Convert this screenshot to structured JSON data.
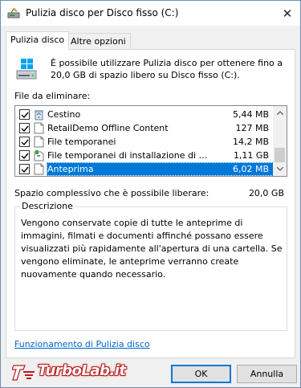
{
  "window": {
    "title": "Pulizia disco per Disco fisso (C:)"
  },
  "tabs": [
    {
      "label": "Pulizia disco"
    },
    {
      "label": "Altre opzioni"
    }
  ],
  "intro": "È possibile utilizzare Pulizia disco per ottenere fino a 20,0 GB di spazio libero su Disco fisso (C:).",
  "files_label": "File da eliminare:",
  "files": [
    {
      "name": "Cestino",
      "size": "5,44 MB",
      "checked": true,
      "icon": "recycle-bin-icon"
    },
    {
      "name": "RetailDemo Offline Content",
      "size": "127 MB",
      "checked": true,
      "icon": "file-icon"
    },
    {
      "name": "File temporanei",
      "size": "14,2 MB",
      "checked": true,
      "icon": "file-icon"
    },
    {
      "name": "File temporanei di installazione di Wind...",
      "size": "1,11 GB",
      "checked": true,
      "icon": "windows-setup-icon"
    },
    {
      "name": "Anteprima",
      "size": "6,02 MB",
      "checked": true,
      "icon": "file-icon"
    }
  ],
  "total": {
    "label": "Spazio complessivo che è possibile liberare:",
    "value": "20,0 GB"
  },
  "description": {
    "title": "Descrizione",
    "text": "Vengono conservate copie di tutte le anteprime di immagini, filmati e documenti affinché possano essere visualizzati più rapidamente all'apertura di una cartella. Se vengono eliminate, le anteprime verranno create nuovamente quando necessario."
  },
  "footer_link": "Funzionamento di Pulizia disco",
  "buttons": {
    "ok": "OK",
    "cancel": "Annulla"
  },
  "watermark": "TurboLab.it",
  "colors": {
    "accent": "#0078d7",
    "link": "#0066cc",
    "brand": "#b71c1c"
  }
}
